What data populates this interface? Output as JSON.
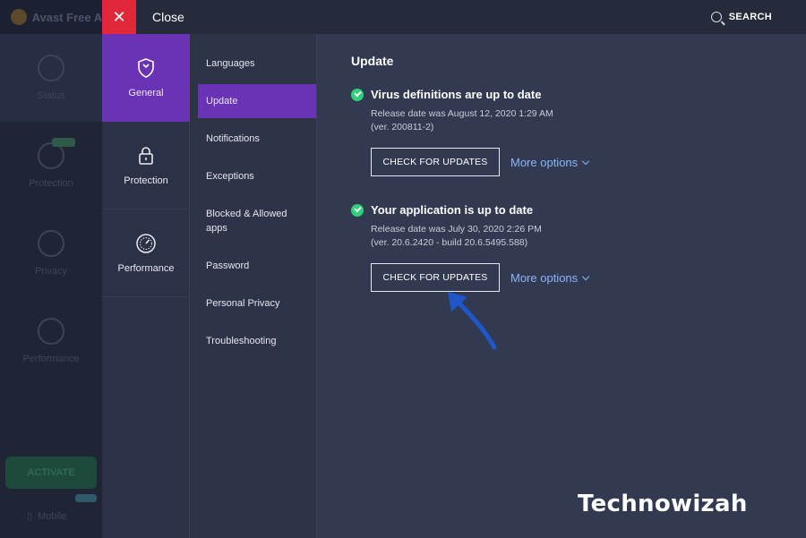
{
  "background_app": {
    "title": "Avast Free A",
    "nav": [
      {
        "label": "Status"
      },
      {
        "label": "Protection"
      },
      {
        "label": "Privacy"
      },
      {
        "label": "Performance"
      }
    ],
    "activate_label": "ACTIVATE",
    "mobile_label": "Mobile"
  },
  "topbar": {
    "close_label": "Close",
    "close_glyph": "✕",
    "search_label": "SEARCH"
  },
  "categories": [
    {
      "label": "General",
      "icon": "shield-icon",
      "active": true
    },
    {
      "label": "Protection",
      "icon": "lock-icon",
      "active": false
    },
    {
      "label": "Performance",
      "icon": "gauge-icon",
      "active": false
    }
  ],
  "subnav": [
    {
      "label": "Languages"
    },
    {
      "label": "Update",
      "active": true
    },
    {
      "label": "Notifications"
    },
    {
      "label": "Exceptions"
    },
    {
      "label": "Blocked & Allowed apps"
    },
    {
      "label": "Password"
    },
    {
      "label": "Personal Privacy"
    },
    {
      "label": "Troubleshooting"
    }
  ],
  "content": {
    "title": "Update",
    "sections": [
      {
        "title": "Virus definitions are up to date",
        "line1": "Release date was August 12, 2020 1:29 AM",
        "line2": "(ver. 200811-2)",
        "button": "CHECK FOR UPDATES",
        "more": "More options"
      },
      {
        "title": "Your application is up to date",
        "line1": "Release date was July 30, 2020 2:26 PM",
        "line2": "(ver. 20.6.2420 - build 20.6.5495.588)",
        "button": "CHECK FOR UPDATES",
        "more": "More options"
      }
    ]
  },
  "watermark": "Technowizah",
  "colors": {
    "accent": "#6a32b5",
    "close": "#e0283a",
    "ok": "#2fd07a",
    "link": "#8eb4f2"
  }
}
